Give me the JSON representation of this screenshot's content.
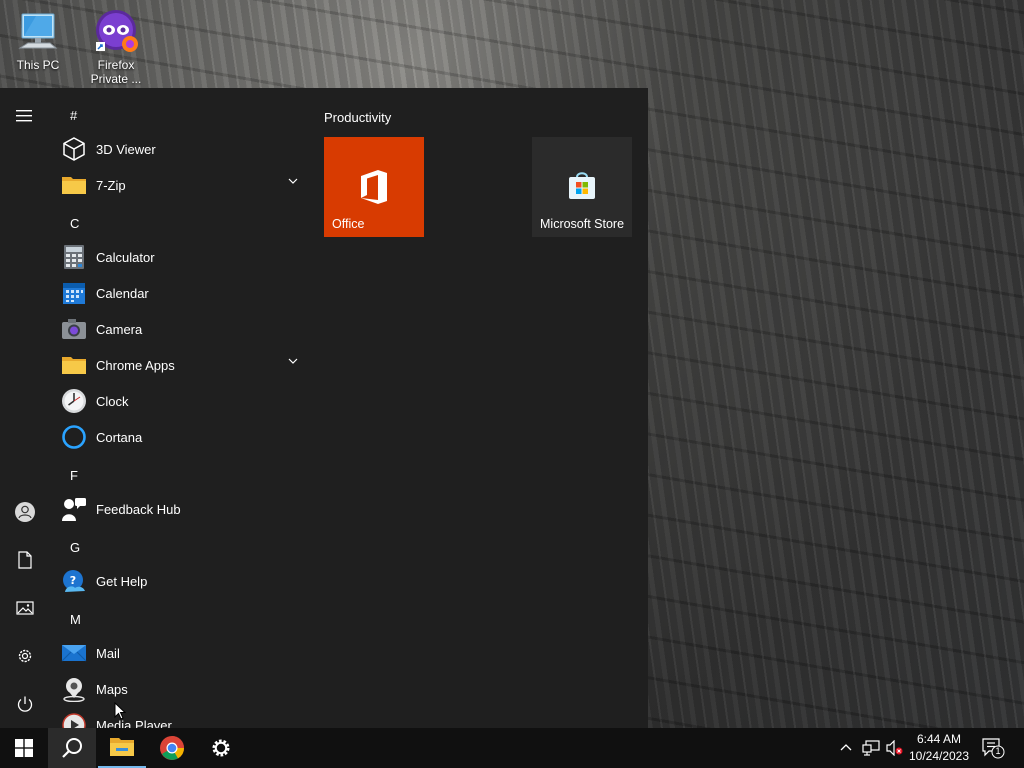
{
  "desktop": {
    "icons": [
      {
        "label": "This PC"
      },
      {
        "label": "Firefox Private ..."
      }
    ]
  },
  "start_menu": {
    "rail": [
      "hamburger-icon",
      "user-icon",
      "documents-icon",
      "pictures-icon",
      "settings-icon",
      "power-icon"
    ],
    "headers": {
      "hash": "#",
      "c": "C",
      "f": "F",
      "g": "G",
      "m": "M"
    },
    "apps": {
      "viewer3d": "3D Viewer",
      "zip": "7-Zip",
      "calculator": "Calculator",
      "calendar": "Calendar",
      "camera": "Camera",
      "chrome_apps": "Chrome Apps",
      "clock": "Clock",
      "cortana": "Cortana",
      "feedback": "Feedback Hub",
      "gethelp": "Get Help",
      "mail": "Mail",
      "maps": "Maps",
      "media_player": "Media Player"
    },
    "tiles": {
      "group_title": "Productivity",
      "office": "Office",
      "store": "Microsoft Store"
    }
  },
  "taskbar": {
    "items": [
      "start",
      "search",
      "file-explorer",
      "chrome",
      "settings"
    ],
    "time": "6:44 AM",
    "date": "10/24/2023",
    "notification_count": "1"
  },
  "colors": {
    "menu_bg": "#1f1f1f",
    "taskbar_bg": "#101010",
    "office_tile": "#d83b01",
    "store_tile": "#2b2b2b"
  }
}
